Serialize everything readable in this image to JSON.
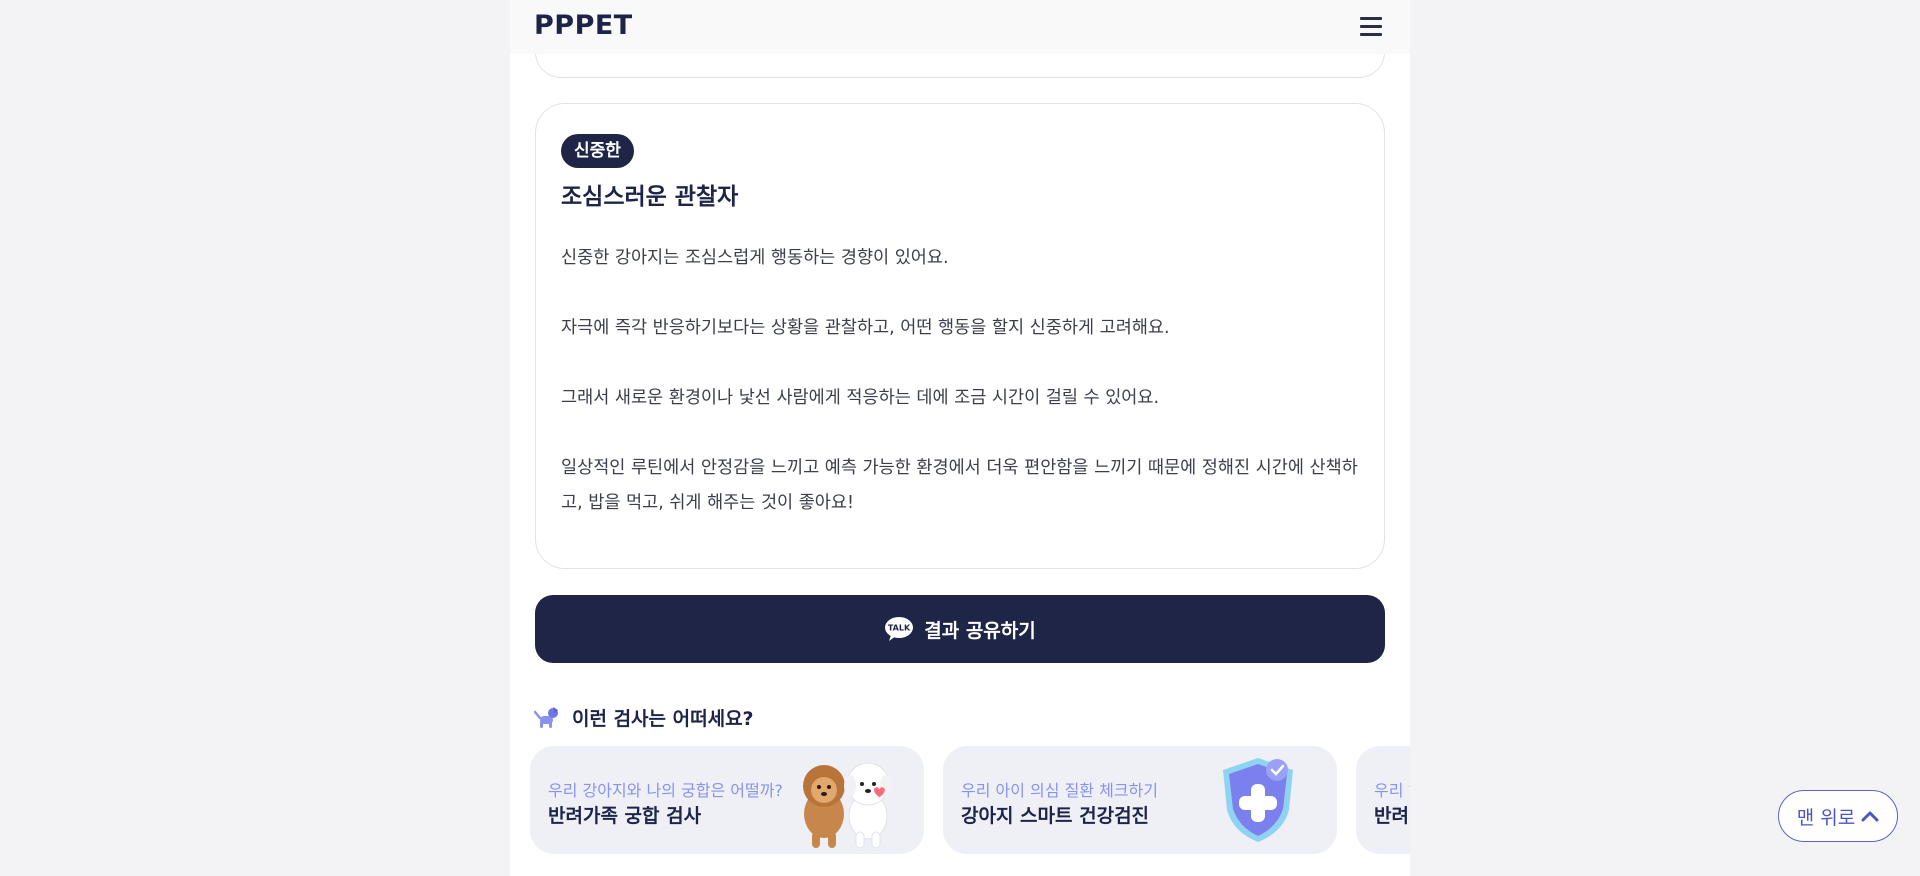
{
  "header": {
    "logo": "PPPET",
    "menu_icon": "hamburger-icon"
  },
  "result_card": {
    "badge": "신중한",
    "title": "조심스러운 관찰자",
    "paragraphs": [
      "신중한 강아지는 조심스럽게 행동하는 경향이 있어요.",
      "자극에 즉각 반응하기보다는 상황을 관찰하고, 어떤 행동을 할지 신중하게 고려해요.",
      "그래서 새로운 환경이나 낯선 사람에게 적응하는 데에 조금 시간이 걸릴 수 있어요.",
      "일상적인 루틴에서 안정감을 느끼고 예측 가능한 환경에서 더욱 편안함을 느끼기 때문에 정해진 시간에 산책하고, 밥을 먹고, 쉬게 해주는 것이 좋아요!"
    ]
  },
  "share_button": {
    "label": "결과 공유하기",
    "icon": "kakao-talk-icon"
  },
  "recommend": {
    "title": "이런 검사는 어떠세요?",
    "icon": "dog-icon",
    "items": [
      {
        "subtitle": "우리 강아지와 나의 궁합은 어떨까?",
        "title": "반려가족 궁합 검사",
        "image": "dog-friends-illustration"
      },
      {
        "subtitle": "우리 아이 의심 질환 체크하기",
        "title": "강아지 스마트 건강검진",
        "image": "health-shield-illustration"
      },
      {
        "subtitle": "우리 ?",
        "title": "반려?",
        "image": ""
      }
    ]
  },
  "top_button": {
    "label": "맨 위로",
    "icon": "chevron-up-icon"
  },
  "colors": {
    "navy": "#1f2547",
    "accent": "#8a92ef",
    "card_bg": "#eef0f6"
  }
}
